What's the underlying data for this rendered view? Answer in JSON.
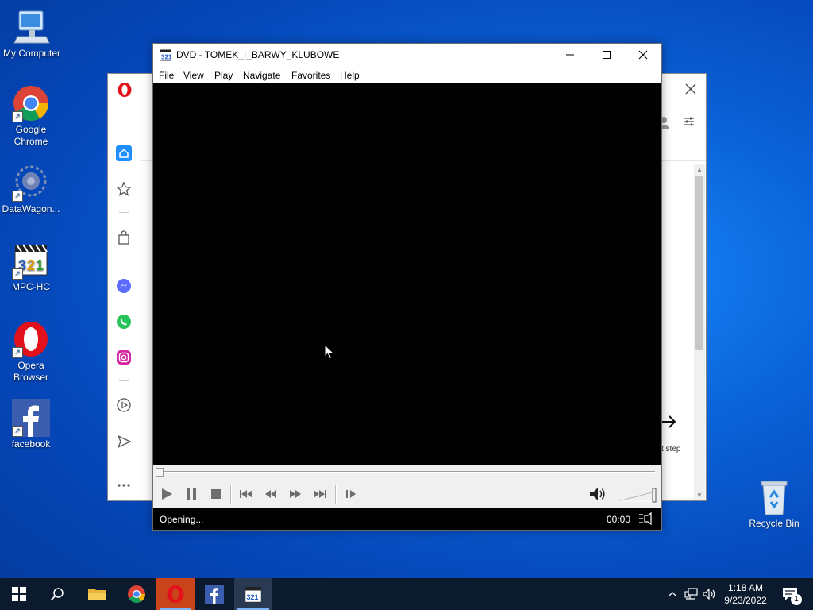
{
  "desktop": {
    "icons": [
      {
        "label": "My Computer"
      },
      {
        "label": "Google Chrome"
      },
      {
        "label": "DataWagon..."
      },
      {
        "label": "MPC-HC"
      },
      {
        "label": "Opera Browser"
      },
      {
        "label": "facebook"
      },
      {
        "label": "Recycle Bin"
      }
    ]
  },
  "opera_window": {
    "partial_text": "t step"
  },
  "mpc": {
    "title": "DVD - TOMEK_I_BARWY_KLUBOWE",
    "menu": [
      "File",
      "View",
      "Play",
      "Navigate",
      "Favorites",
      "Help"
    ],
    "status_text": "Opening...",
    "time": "00:00",
    "seek_position": 0,
    "volume_level": 1.0
  },
  "taskbar": {
    "time": "1:18 AM",
    "date": "9/23/2022",
    "notification_count": "1"
  },
  "colors": {
    "desktop_blue": "#0a63d8",
    "taskbar": "#0c1a2e",
    "opera_red": "#e3111b",
    "opera_accent": "#1f8fff",
    "video_bg": "#000000"
  }
}
